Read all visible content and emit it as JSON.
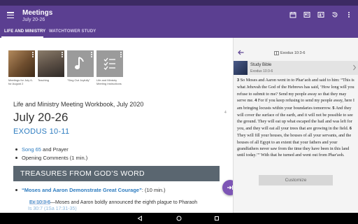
{
  "appbar": {
    "title": "Meetings",
    "subtitle": "July 20-26",
    "actions": [
      "calendar-icon",
      "tablet-icon",
      "contact-icon",
      "history-icon",
      "more-icon"
    ]
  },
  "tabs": [
    {
      "label": "LIFE AND MINISTRY",
      "active": true
    },
    {
      "label": "WATCHTOWER STUDY",
      "active": false
    }
  ],
  "article": {
    "thumbnails": [
      {
        "caption": "Meetings for July 6-for August 2"
      },
      {
        "caption": "Teaching"
      },
      {
        "caption": "\"Sing Out Joyfully\""
      },
      {
        "caption": "Life and Ministry Meeting Instructions"
      }
    ],
    "workbook": "Life and Ministry Meeting Workbook, July 2020",
    "hash": "4",
    "date_heading": "July 20-26",
    "book_heading": "EXODUS 10-11",
    "song_link": "Song 65",
    "song_rest": " and Prayer",
    "opening": "Opening Comments (1 min.)",
    "section": "TREASURES FROM GOD’S WORD",
    "part_title": "“Moses and Aaron Demonstrate Great Courage”",
    "part_duration": ": (10 min.)",
    "ref_link": "Ex 10:3-6",
    "ref_text": "—Moses and Aaron boldly announced the eighth plague to Pharaoh",
    "cut_line": "Is 30:7 (1Sa 17:31-35)"
  },
  "pane": {
    "reference": "Exodus 10:3-6",
    "source_name": "Study Bible",
    "source_ref": "Exodus 10:3-6",
    "verses": [
      {
        "num": "3",
        "text": "So Moses and Aaron went in to Pharʹaoh and said to him: “This is what Jehovah the God of the Hebrews has said, ‘How long will you refuse to submit to me? Send my people away so that they may serve me. "
      },
      {
        "num": "4",
        "text": "For if you keep refusing to send my people away, here I am bringing locusts within your boundaries tomorrow. "
      },
      {
        "num": "5",
        "text": "And they will cover the surface of the earth, and it will not be possible to see the ground. They will eat up what escaped the hail and was left for you, and they will eat all your trees that are growing in the field. "
      },
      {
        "num": "6",
        "text": "They will fill your houses, the houses of all your servants, and the houses of all Egypt to an extent that your fathers and your grandfathers never saw from the time they have been in this land until today.’” With that he turned and went out from Pharʹaoh."
      }
    ],
    "customize_label": "Customize"
  }
}
